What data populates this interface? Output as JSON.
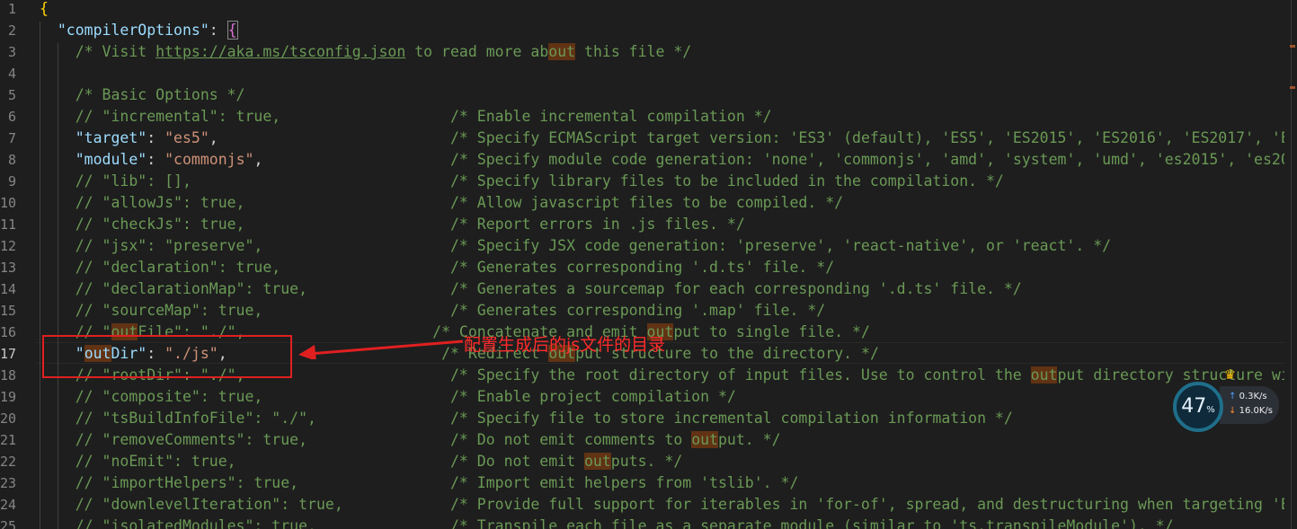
{
  "lines": [
    {
      "n": "1",
      "segs": [
        {
          "t": "{",
          "c": "b1"
        }
      ]
    },
    {
      "n": "2",
      "segs": [
        {
          "t": "  "
        },
        {
          "t": "\"compilerOptions\"",
          "c": "k"
        },
        {
          "t": ": ",
          "c": "p"
        },
        {
          "t": "{",
          "c": "b2"
        }
      ]
    },
    {
      "n": "3",
      "segs": [
        {
          "t": "    "
        },
        {
          "t": "/* Visit ",
          "c": "c"
        },
        {
          "t": "https://aka.ms/tsconfig.json",
          "c": "c u"
        },
        {
          "t": " to read more ab",
          "c": "c"
        },
        {
          "t": "out",
          "c": "c hl"
        },
        {
          "t": " this file */",
          "c": "c"
        }
      ]
    },
    {
      "n": "4",
      "segs": []
    },
    {
      "n": "5",
      "segs": [
        {
          "t": "    "
        },
        {
          "t": "/* Basic Options */",
          "c": "c"
        }
      ]
    },
    {
      "n": "6",
      "segs": [
        {
          "t": "    "
        },
        {
          "t": "// \"incremental\": true,                   /* Enable incremental compilation */",
          "c": "c"
        }
      ]
    },
    {
      "n": "7",
      "segs": [
        {
          "t": "    "
        },
        {
          "t": "\"target\"",
          "c": "k"
        },
        {
          "t": ": ",
          "c": "p"
        },
        {
          "t": "\"es5\"",
          "c": "s"
        },
        {
          "t": ",",
          "c": "p"
        },
        {
          "t": "                          "
        },
        {
          "t": "/* Specify ECMAScript target version: 'ES3' (default), 'ES5', 'ES2015', 'ES2016', 'ES2017', 'E",
          "c": "c"
        }
      ]
    },
    {
      "n": "8",
      "segs": [
        {
          "t": "    "
        },
        {
          "t": "\"module\"",
          "c": "k"
        },
        {
          "t": ": ",
          "c": "p"
        },
        {
          "t": "\"commonjs\"",
          "c": "s"
        },
        {
          "t": ",",
          "c": "p"
        },
        {
          "t": "                     "
        },
        {
          "t": "/* Specify module code generation: 'none', 'commonjs', 'amd', 'system', 'umd', 'es2015', 'es20",
          "c": "c"
        }
      ]
    },
    {
      "n": "9",
      "segs": [
        {
          "t": "    "
        },
        {
          "t": "// \"lib\": [],                             /* Specify library files to be included in the compilation. */",
          "c": "c"
        }
      ]
    },
    {
      "n": "10",
      "segs": [
        {
          "t": "    "
        },
        {
          "t": "// \"allowJs\": true,                       /* Allow javascript files to be compiled. */",
          "c": "c"
        }
      ]
    },
    {
      "n": "11",
      "segs": [
        {
          "t": "    "
        },
        {
          "t": "// \"checkJs\": true,                       /* Report errors in .js files. */",
          "c": "c"
        }
      ]
    },
    {
      "n": "12",
      "segs": [
        {
          "t": "    "
        },
        {
          "t": "// \"jsx\": \"preserve\",                     /* Specify JSX code generation: 'preserve', 'react-native', or 'react'. */",
          "c": "c"
        }
      ]
    },
    {
      "n": "13",
      "segs": [
        {
          "t": "    "
        },
        {
          "t": "// \"declaration\": true,                   /* Generates corresponding '.d.ts' file. */",
          "c": "c"
        }
      ]
    },
    {
      "n": "14",
      "segs": [
        {
          "t": "    "
        },
        {
          "t": "// \"declarationMap\": true,                /* Generates a sourcemap for each corresponding '.d.ts' file. */",
          "c": "c"
        }
      ]
    },
    {
      "n": "15",
      "segs": [
        {
          "t": "    "
        },
        {
          "t": "// \"sourceMap\": true,                     /* Generates corresponding '.map' file. */",
          "c": "c"
        }
      ]
    },
    {
      "n": "16",
      "segs": [
        {
          "t": "    "
        },
        {
          "t": "// \"",
          "c": "c"
        },
        {
          "t": "out",
          "c": "c hl"
        },
        {
          "t": "File\": \"./\",                     /* Concatenate and emit ",
          "c": "c"
        },
        {
          "t": "out",
          "c": "c hl"
        },
        {
          "t": "put to single file. */",
          "c": "c"
        }
      ]
    },
    {
      "n": "17",
      "cur": true,
      "segs": [
        {
          "t": "    "
        },
        {
          "t": "\"",
          "c": "k"
        },
        {
          "t": "out",
          "c": "k hl"
        },
        {
          "t": "Dir\"",
          "c": "k"
        },
        {
          "t": ": ",
          "c": "p"
        },
        {
          "t": "\"./js\"",
          "c": "s"
        },
        {
          "t": ",",
          "c": "p"
        },
        {
          "t": "                        "
        },
        {
          "t": "/* Redirect ",
          "c": "c"
        },
        {
          "t": "out",
          "c": "c hl"
        },
        {
          "t": "put structure to the directory. */",
          "c": "c"
        }
      ]
    },
    {
      "n": "18",
      "segs": [
        {
          "t": "    "
        },
        {
          "t": "// \"rootDir\": \"./\",                       /* Specify the root directory of input files. Use to control the ",
          "c": "c"
        },
        {
          "t": "out",
          "c": "c hl"
        },
        {
          "t": "put directory structure wi",
          "c": "c"
        }
      ]
    },
    {
      "n": "19",
      "segs": [
        {
          "t": "    "
        },
        {
          "t": "// \"composite\": true,                     /* Enable project compilation */",
          "c": "c"
        }
      ]
    },
    {
      "n": "20",
      "segs": [
        {
          "t": "    "
        },
        {
          "t": "// \"tsBuildInfoFile\": \"./\",               /* Specify file to store incremental compilation information */",
          "c": "c"
        }
      ]
    },
    {
      "n": "21",
      "segs": [
        {
          "t": "    "
        },
        {
          "t": "// \"removeComments\": true,                /* Do not emit comments to ",
          "c": "c"
        },
        {
          "t": "out",
          "c": "c hl"
        },
        {
          "t": "put. */",
          "c": "c"
        }
      ]
    },
    {
      "n": "22",
      "segs": [
        {
          "t": "    "
        },
        {
          "t": "// \"noEmit\": true,                        /* Do not emit ",
          "c": "c"
        },
        {
          "t": "out",
          "c": "c hl"
        },
        {
          "t": "puts. */",
          "c": "c"
        }
      ]
    },
    {
      "n": "23",
      "segs": [
        {
          "t": "    "
        },
        {
          "t": "// \"importHelpers\": true,                 /* Import emit helpers from 'tslib'. */",
          "c": "c"
        }
      ]
    },
    {
      "n": "24",
      "segs": [
        {
          "t": "    "
        },
        {
          "t": "// \"downlevelIteration\": true,            /* Provide full support for iterables in 'for-of', spread, and destructuring when targeting 'E",
          "c": "c"
        }
      ]
    },
    {
      "n": "25",
      "segs": [
        {
          "t": "    "
        },
        {
          "t": "// \"isolatedModules\": true,               /* Transpile each file as a separate module (similar to 'ts.transpileModule'). */",
          "c": "c"
        }
      ]
    }
  ],
  "annotation": {
    "text": "配置生成后的js文件的目录",
    "color": "#ff2a2a"
  },
  "net_monitor": {
    "percent": "47",
    "percent_unit": "%",
    "upload": "0.3K/s",
    "download": "16.0K/s",
    "badge": "VIP"
  },
  "colors": {
    "background": "#1e1e1e",
    "comment": "#6a9955",
    "key": "#9cdcfe",
    "string": "#ce9178",
    "highlight": "#613214"
  }
}
